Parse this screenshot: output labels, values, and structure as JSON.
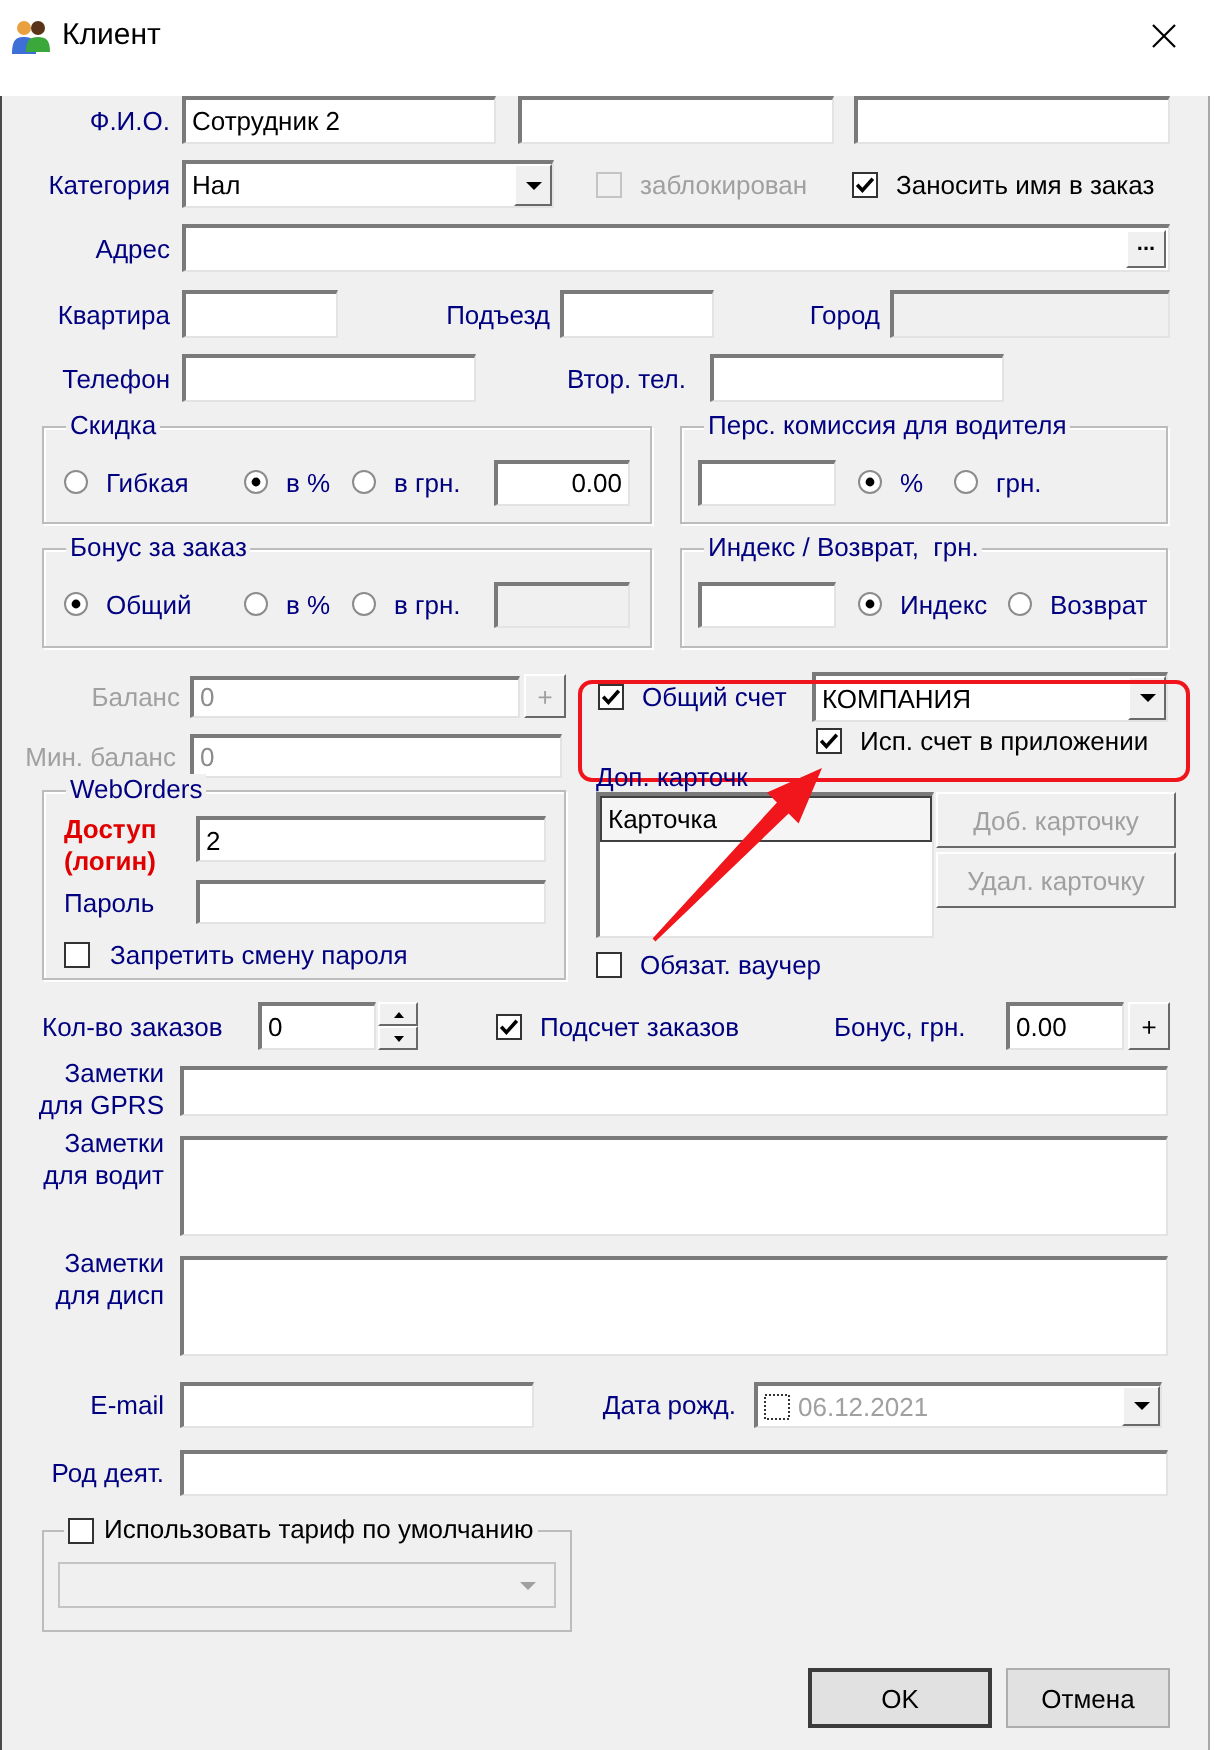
{
  "window": {
    "title": "Клиент"
  },
  "fio": {
    "label": "Ф.И.О.",
    "fields": [
      {
        "value": "Сотрудник 2",
        "disabled": false
      },
      {
        "disabled": false
      },
      {
        "disabled": false
      }
    ]
  },
  "category": {
    "label": "Категория",
    "value": "Нал"
  },
  "checks_top": [
    {
      "label": "заблокирован",
      "checked": false,
      "disabled": true
    },
    {
      "label": "Заносить имя в заказ",
      "checked": true,
      "disabled": false
    }
  ],
  "address": {
    "label": "Адрес",
    "button": "..."
  },
  "apartment_row": [
    {
      "label": "Квартира",
      "disabled": false
    },
    {
      "label": "Подъезд",
      "disabled": false
    },
    {
      "label": "Город",
      "disabled": true
    }
  ],
  "phone_row": [
    {
      "label": "Телефон"
    },
    {
      "label": "Втор. тел."
    }
  ],
  "discount": {
    "title": "Скидка",
    "options": [
      {
        "label": "Гибкая",
        "selected": false
      },
      {
        "label": "в %",
        "selected": true
      },
      {
        "label": "в грн.",
        "selected": false
      }
    ],
    "value": "0.00",
    "disabled": false
  },
  "driver_commission": {
    "title": "Перс. комиссия для водителя",
    "options": [
      {
        "label": "%",
        "selected": true
      },
      {
        "label": "грн.",
        "selected": false
      }
    ]
  },
  "order_bonus": {
    "title": "Бонус за заказ",
    "options": [
      {
        "label": "Общий",
        "selected": true
      },
      {
        "label": "в %",
        "selected": false
      },
      {
        "label": "в грн.",
        "selected": false
      }
    ],
    "disabled": true
  },
  "index_return": {
    "title": "Индекс / Возврат,  грн.",
    "options": [
      {
        "label": "Индекс",
        "selected": true
      },
      {
        "label": "Возврат",
        "selected": false
      }
    ]
  },
  "balance": {
    "label": "Баланс",
    "value": "0",
    "disabled": true,
    "button": "+"
  },
  "min_balance": {
    "label": "Мин. баланс",
    "value": "0",
    "disabled": true
  },
  "common_account": {
    "label": "Общий счет",
    "checked": true,
    "value": "КОМПАНИЯ"
  },
  "use_in_app": {
    "label": "Исп. счет в приложении",
    "checked": true
  },
  "extra_cards": {
    "label": "Доп. карточк",
    "column": "Карточка",
    "buttons": [
      {
        "label": "Доб. карточку",
        "disabled": true
      },
      {
        "label": "Удал. карточку",
        "disabled": true
      }
    ]
  },
  "voucher": {
    "label": "Обязат. ваучер",
    "checked": false
  },
  "weborders": {
    "title": "WebOrders",
    "login_label": "Доступ (логин)",
    "login": "2",
    "password_label": "Пароль",
    "forbid_label": "Запретить смену пароля",
    "forbid_checked": false
  },
  "orders": {
    "count_label": "Кол-во заказов",
    "count": "0",
    "counting_label": "Подсчет заказов",
    "counting_checked": true,
    "bonus_label": "Бонус, грн.",
    "bonus": "0.00",
    "bonus_button": "+"
  },
  "notes": [
    {
      "label": "Заметки для GPRS",
      "kind": "short"
    },
    {
      "label": "Заметки для водит",
      "kind": "tall"
    },
    {
      "label": "Заметки для дисп",
      "kind": "tall"
    }
  ],
  "email": {
    "label": "E-mail"
  },
  "birth_date": {
    "label": "Дата рожд.",
    "checked": false,
    "value": "06.12.2021"
  },
  "occupation": {
    "label": "Род деят."
  },
  "default_tariff": {
    "label": "Использовать тариф по умолчанию",
    "checked": false
  },
  "buttons": [
    {
      "label": "OK",
      "default": true
    },
    {
      "label": "Отмена",
      "default": false
    }
  ]
}
